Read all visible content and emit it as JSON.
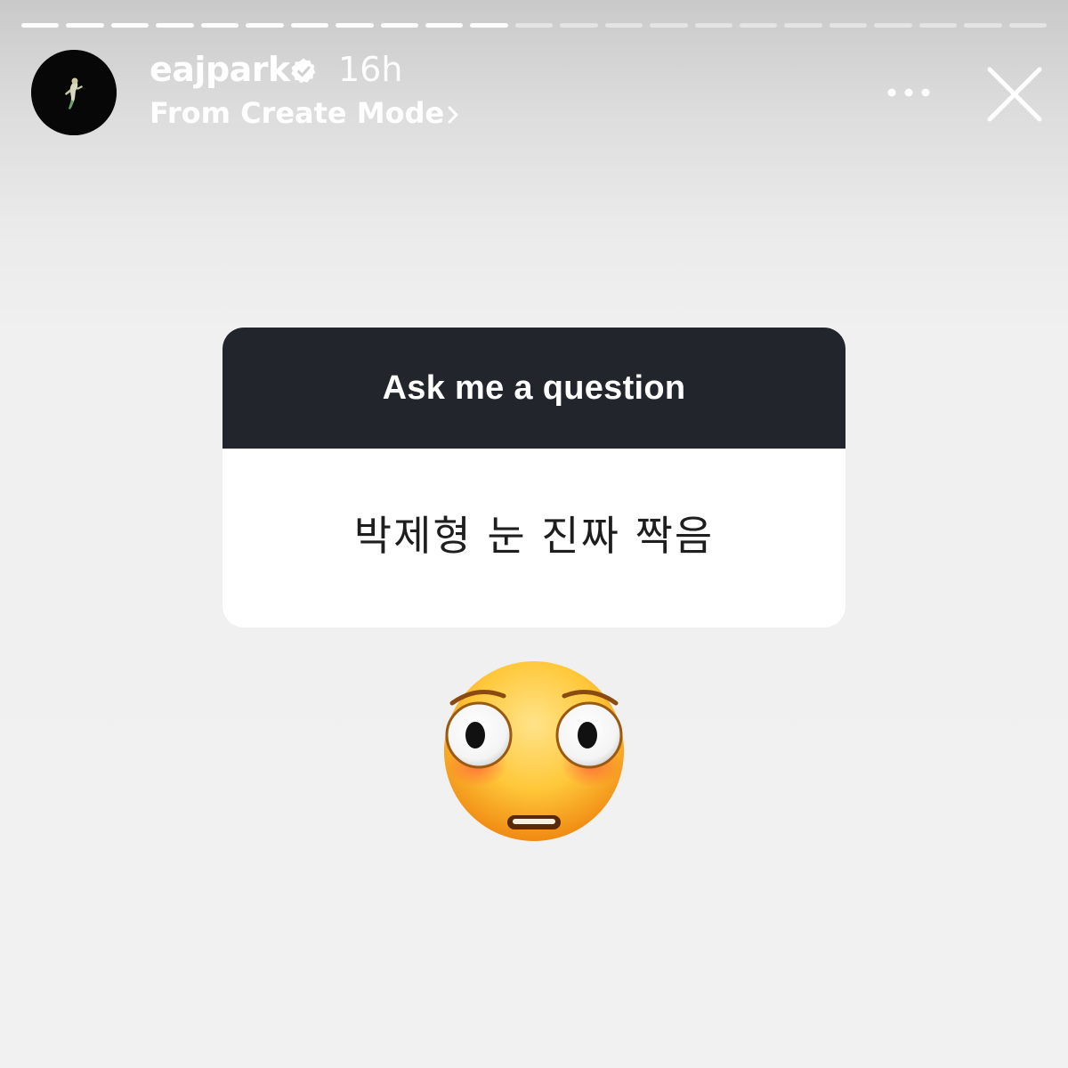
{
  "story": {
    "progress_total_segments": 23,
    "progress_viewed_segments": 11
  },
  "header": {
    "username": "eajpark",
    "verified_icon": "verified-badge-icon",
    "time_ago": "16h",
    "source_label": "From Create Mode",
    "source_chevron_icon": "chevron-right-icon",
    "more_icon": "more-horizontal-icon",
    "close_icon": "close-icon"
  },
  "sticker": {
    "title": "Ask me a question",
    "answer": "박제형 눈 진짜 짝음",
    "header_color": "#22252b",
    "body_color": "#ffffff"
  },
  "reaction": {
    "emoji": "flushed-face-emoji"
  }
}
